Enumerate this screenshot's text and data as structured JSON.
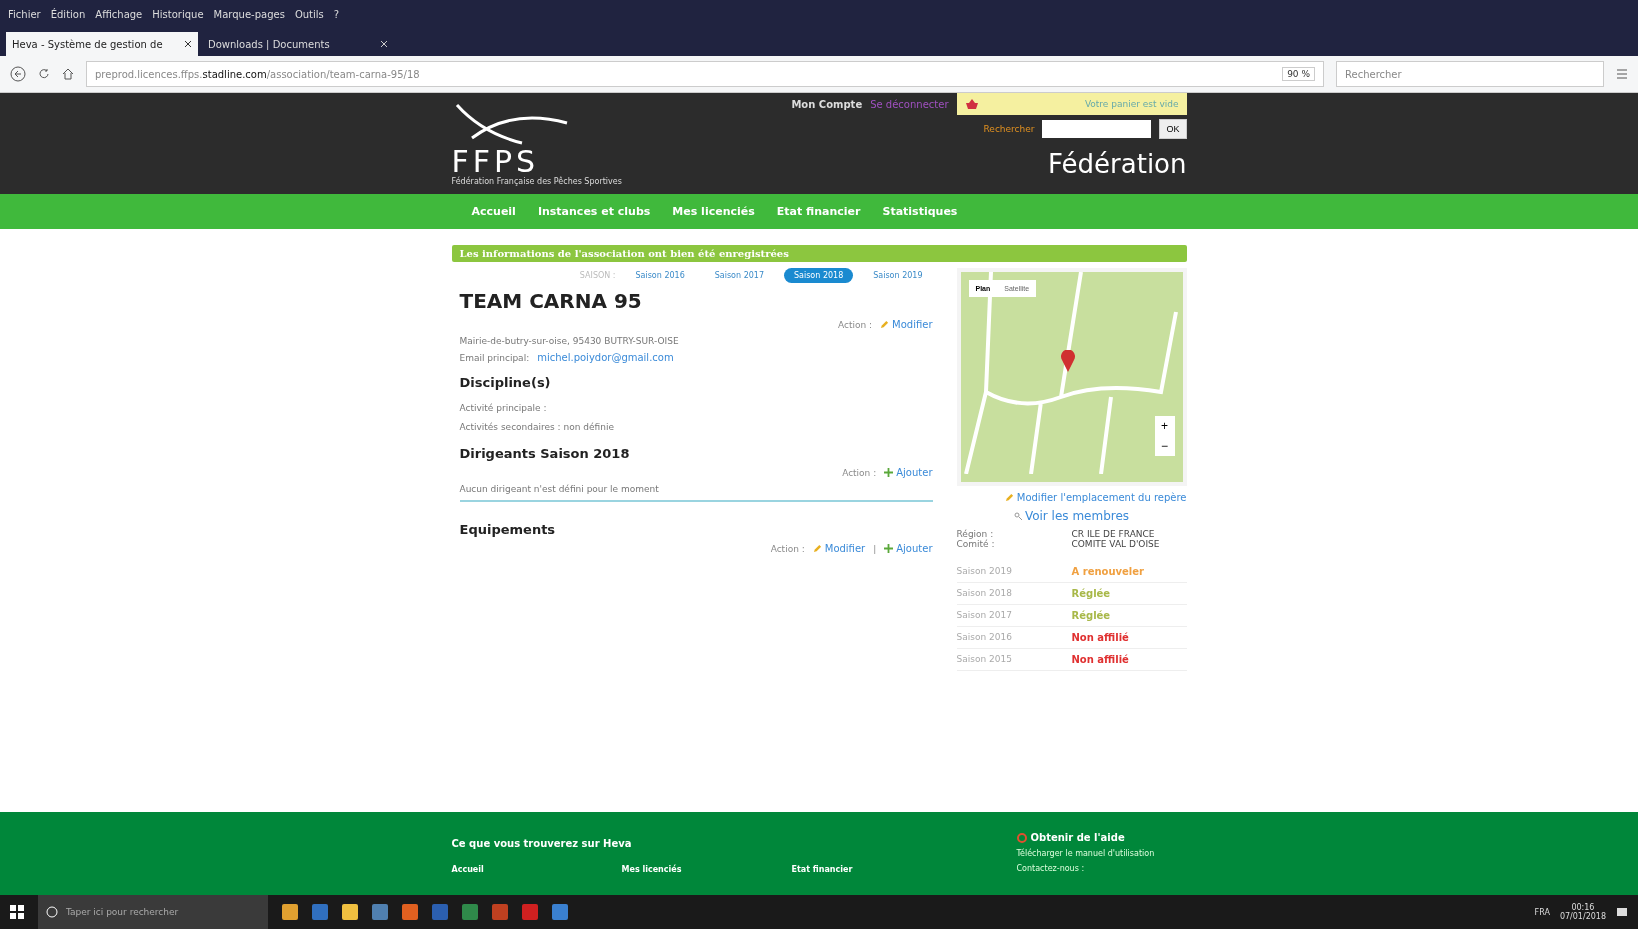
{
  "menu_bar": [
    "Fichier",
    "Édition",
    "Affichage",
    "Historique",
    "Marque-pages",
    "Outils",
    "?"
  ],
  "tabs": [
    {
      "label": "Heva - Système de gestion de",
      "selected": true
    },
    {
      "label": "Downloads | Documents",
      "selected": false
    }
  ],
  "address_bar": {
    "url_prefix": "preprod.licences.ffps.",
    "url_domain": "stadline.com",
    "url_path": "/association/team-carna-95/18",
    "zoom": "90 %",
    "search_placeholder": "Rechercher"
  },
  "header": {
    "account": "Mon Compte",
    "logout": "Se déconnecter",
    "cart": "Votre panier est vide",
    "search_label": "Rechercher",
    "search_button": "OK",
    "logo": "FFPS",
    "logo_subtitle": "Fédération Française des Pêches Sportives",
    "section": "Fédération"
  },
  "nav": [
    "Accueil",
    "Instances et clubs",
    "Mes licenciés",
    "Etat financier",
    "Statistiques"
  ],
  "notice": "Les informations de l'association ont bien été enregistrées",
  "season_label": "SAISON :",
  "seasons": [
    {
      "label": "Saison 2016",
      "selected": false
    },
    {
      "label": "Saison 2017",
      "selected": false
    },
    {
      "label": "Saison 2018",
      "selected": true
    },
    {
      "label": "Saison 2019",
      "selected": false
    }
  ],
  "club": {
    "name": "TEAM CARNA 95",
    "action_label": "Action :",
    "edit": "Modifier",
    "address": "Mairie-de-butry-sur-oise, 95430 BUTRY-SUR-OISE",
    "email_label": "Email principal:",
    "email": "michel.poiydor@gmail.com"
  },
  "discipline": {
    "title": "Discipline(s)",
    "lines": [
      "Activité principale :",
      "Activités secondaires : non définie"
    ]
  },
  "leaders": {
    "title": "Dirigeants Saison 2018",
    "action_label": "Action :",
    "add": "Ajouter",
    "empty": "Aucun dirigeant n'est défini pour le moment"
  },
  "equipment": {
    "title": "Equipements",
    "action_label": "Action :",
    "edit": "Modifier",
    "separator": "|",
    "add": "Ajouter"
  },
  "map": {
    "map_type": [
      {
        "label": "Plan",
        "selected": true
      },
      {
        "label": "Satellite",
        "selected": false
      }
    ],
    "zoom_in": "+",
    "zoom_out": "−"
  },
  "map_link": "Modifier l'emplacement du repère",
  "members_link": "Voir les membres",
  "info": [
    {
      "label": "Région :",
      "value": "CR ILE DE FRANCE"
    },
    {
      "label": "Comité :",
      "value": "COMITE VAL D'OISE"
    }
  ],
  "season_status": [
    {
      "season": "Saison 2019",
      "status": "A renouveler",
      "color": "#f0a040"
    },
    {
      "season": "Saison 2018",
      "status": "Réglée",
      "color": "#a8b848"
    },
    {
      "season": "Saison 2017",
      "status": "Réglée",
      "color": "#a8b848"
    },
    {
      "season": "Saison 2016",
      "status": "Non affilié",
      "color": "#e03030"
    },
    {
      "season": "Saison 2015",
      "status": "Non affilié",
      "color": "#e03030"
    }
  ],
  "footer": {
    "title": "Ce que vous trouverez sur Heva",
    "links": [
      "Accueil",
      "Mes licenciés",
      "Etat financier"
    ],
    "help_title": "Obtenir de l'aide",
    "help_links": [
      "Télécharger le manuel d'utilisation",
      "Contactez-nous :"
    ]
  },
  "taskbar": {
    "search_placeholder": "Taper ici pour rechercher",
    "language": "FRA",
    "time": "00:16",
    "date": "07/01/2018"
  }
}
